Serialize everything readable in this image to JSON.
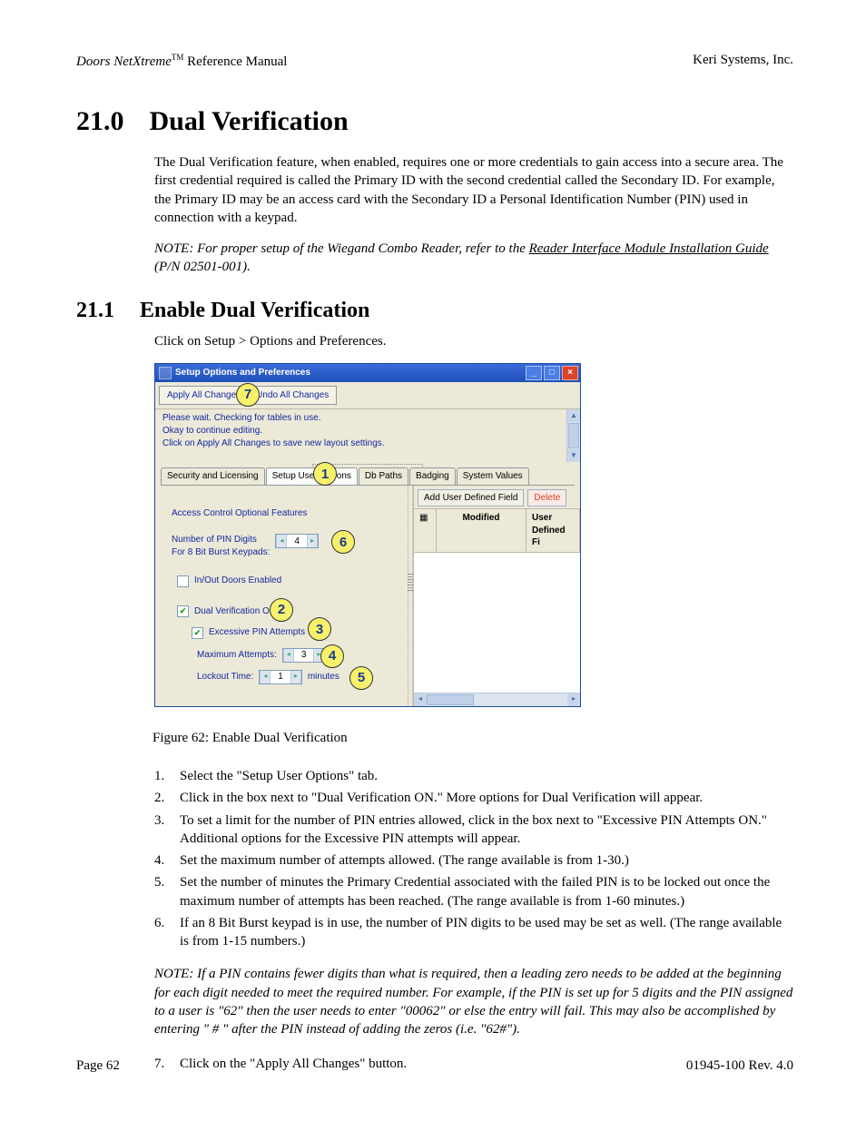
{
  "header": {
    "product": "Doors NetXtreme",
    "tm": "TM",
    "doc_type": " Reference Manual",
    "company": "Keri Systems, Inc."
  },
  "h1": {
    "num": "21.0",
    "title": "Dual Verification"
  },
  "intro": "The Dual Verification feature, when enabled, requires one or more credentials to gain access into a secure area. The first credential required is called the Primary ID with the second credential called the Secondary ID. For example, the Primary ID may be an access card with the Secondary ID a Personal Identification Number (PIN) used in connection with a keypad.",
  "note1_pre": "NOTE: For proper setup of the Wiegand Combo Reader, refer to the ",
  "note1_link": "Reader Interface Module Installation Guide",
  "note1_post": " (P/N 02501-001).",
  "h2": {
    "num": "21.1",
    "title": "Enable Dual Verification"
  },
  "click_path": "Click on Setup > Options and Preferences.",
  "window": {
    "title": "Setup Options and Preferences",
    "btn_apply": "Apply All Changes",
    "btn_undo": "Undo All Changes",
    "status1": "Please wait.  Checking for tables in use.",
    "status2": "Okay to continue editing.",
    "status3": "Click on Apply All Changes to save new layout settings.",
    "tabs": {
      "t1": "Security and Licensing",
      "t2": "Setup User Options",
      "t3": "Db Paths",
      "t4": "Badging",
      "t5": "System Values"
    },
    "opt_title": "Access Control Optional Features",
    "pin_label1": "Number of PIN Digits",
    "pin_label2": "For 8 Bit Burst Keypads:",
    "pin_value": "4",
    "inout": "In/Out Doors Enabled",
    "dual_on": "Dual Verification ON",
    "excessive": "Excessive PIN Attempts ON",
    "max_attempts_label": "Maximum Attempts:",
    "max_attempts_value": "3",
    "lockout_label": "Lockout Time:",
    "lockout_value": "1",
    "lockout_unit": "minutes",
    "btn_add_field": "Add User Defined Field",
    "btn_delete": "Delete",
    "col_modified": "Modified",
    "col_userdef": "User Defined Fi"
  },
  "callouts": {
    "c1": "1",
    "c2": "2",
    "c3": "3",
    "c4": "4",
    "c5": "5",
    "c6": "6",
    "c7": "7"
  },
  "fig_caption": "Figure 62: Enable Dual Verification",
  "steps": [
    "Select the \"Setup User Options\" tab.",
    "Click in the box next to \"Dual Verification ON.\" More options for Dual Verification will appear.",
    "To set a limit for the number of PIN entries allowed, click in the box next to \"Excessive PIN Attempts ON.\" Additional options for the Excessive PIN attempts will appear.",
    "Set the maximum number of attempts allowed. (The range available is from 1-30.)",
    "Set the number of minutes the Primary Credential associated with the failed PIN is to be locked out once the maximum number of attempts has been reached. (The range available is from 1-60 minutes.)",
    "If an 8 Bit Burst keypad is in use, the number of PIN digits to be used may be set as well. (The range available is from 1-15 numbers.)"
  ],
  "note2": "NOTE: If a PIN contains fewer digits than what is required, then a leading zero needs to be added at the beginning for each digit needed to meet the required number. For example, if the PIN is set up for 5 digits and the PIN assigned to a user is \"62\" then the user needs to enter \"00062\" or else the entry will fail. This may also be accomplished by entering \" # \" after the PIN instead of adding the zeros (i.e. \"62#\").",
  "step7_num": "7.",
  "step7": "Click on the \"Apply All Changes\" button.",
  "footer": {
    "page": "Page 62",
    "rev": "01945-100  Rev. 4.0"
  }
}
